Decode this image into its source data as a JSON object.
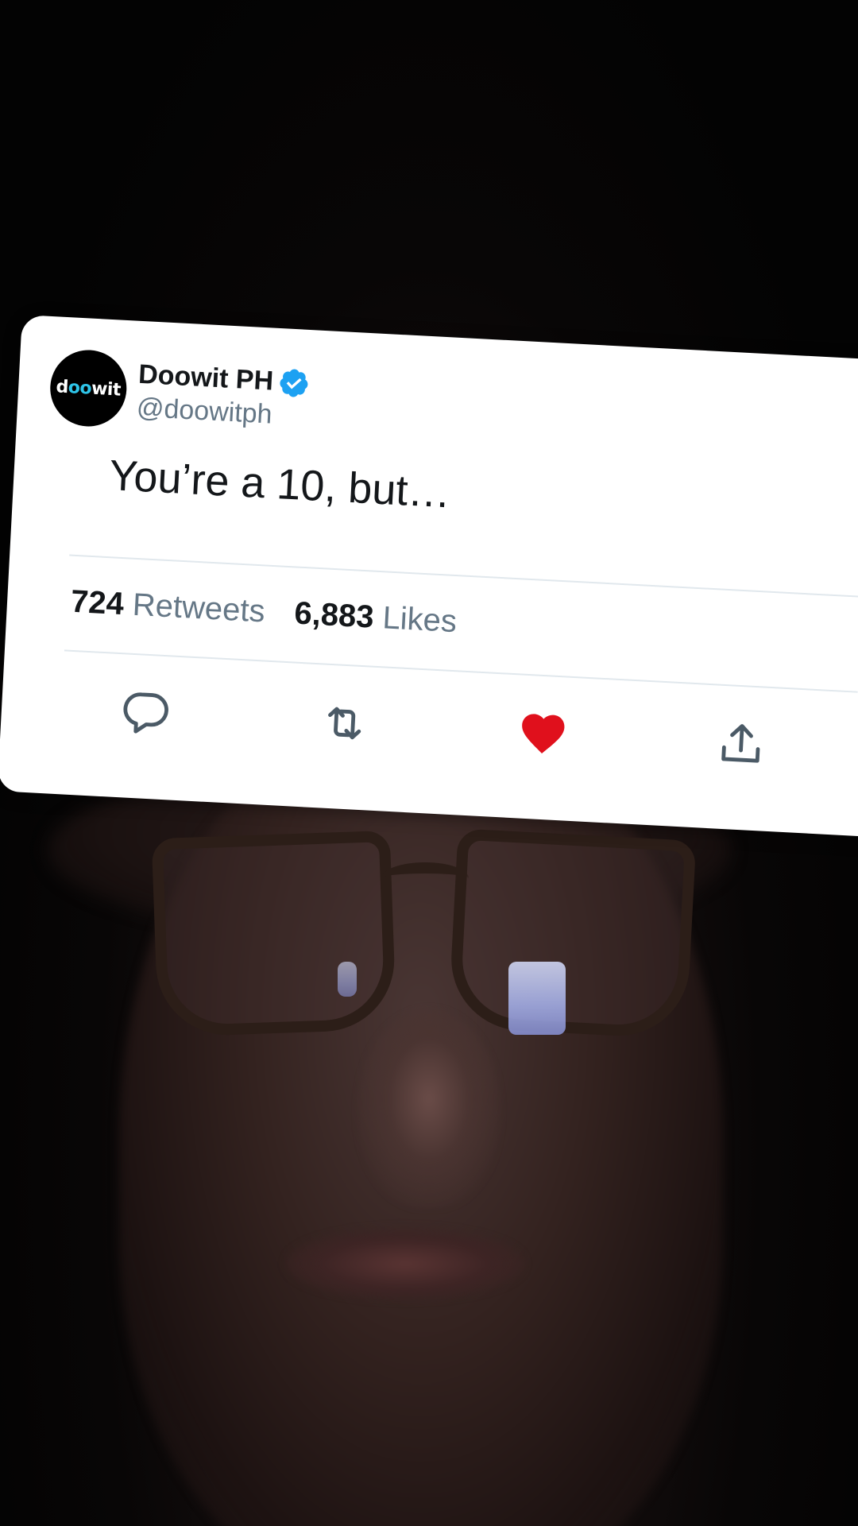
{
  "tweet": {
    "avatar_text_a": "d",
    "avatar_text_oo": "oo",
    "avatar_text_b": "wit",
    "display_name": "Doowit PH",
    "handle": "@doowitph",
    "text": "You’re a 10, but…",
    "retweets_count": "724",
    "retweets_label": "Retweets",
    "likes_count": "6,883",
    "likes_label": "Likes",
    "liked": true
  },
  "colors": {
    "verified": "#1da1f2",
    "like": "#e0101c",
    "icon": "#4b5a66",
    "avatar_accent": "#2ec4e8"
  },
  "icons": {
    "reply": "reply-icon",
    "retweet": "retweet-icon",
    "like": "heart-icon",
    "share": "share-icon",
    "verified": "verified-badge-icon"
  }
}
